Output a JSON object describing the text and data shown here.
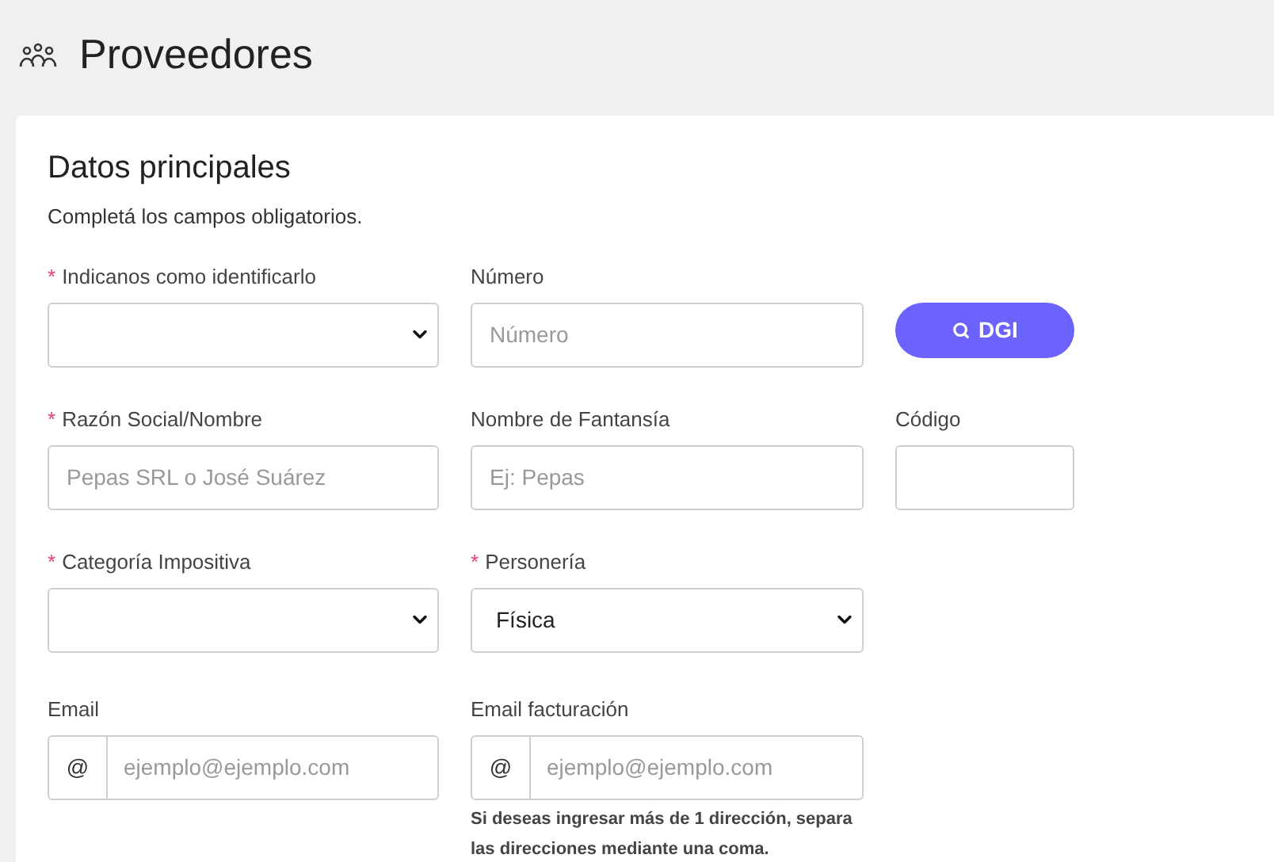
{
  "header": {
    "title": "Proveedores"
  },
  "card": {
    "title": "Datos principales",
    "subtitle": "Completá los campos obligatorios."
  },
  "rows": [
    [
      {
        "kind": "select",
        "label": "Indicanos como identificarlo",
        "required_mark": "*"
      },
      {
        "kind": "input",
        "label": "Número",
        "placeholder": "Número"
      },
      {
        "kind": "button",
        "label": "DGI"
      }
    ],
    [
      {
        "kind": "input",
        "label": "Razón Social/Nombre",
        "required_mark": "*",
        "placeholder": "Pepas SRL o José Suárez"
      },
      {
        "kind": "input",
        "label": "Nombre de Fantansía",
        "placeholder": "Ej: Pepas"
      },
      {
        "kind": "input",
        "label": "Código"
      }
    ],
    [
      {
        "kind": "select",
        "label": "Categoría Impositiva",
        "required_mark": "*"
      },
      {
        "kind": "select",
        "label": "Personería",
        "required_mark": "*",
        "value": "Física"
      }
    ],
    [
      {
        "kind": "prefixed",
        "label": "Email",
        "prefix": "@",
        "placeholder": "ejemplo@ejemplo.com"
      },
      {
        "kind": "prefixed",
        "label": "Email facturación",
        "prefix": "@",
        "placeholder": "ejemplo@ejemplo.com",
        "hint": "Si deseas ingresar más de 1 dirección, separa las direcciones mediante una coma."
      }
    ]
  ]
}
